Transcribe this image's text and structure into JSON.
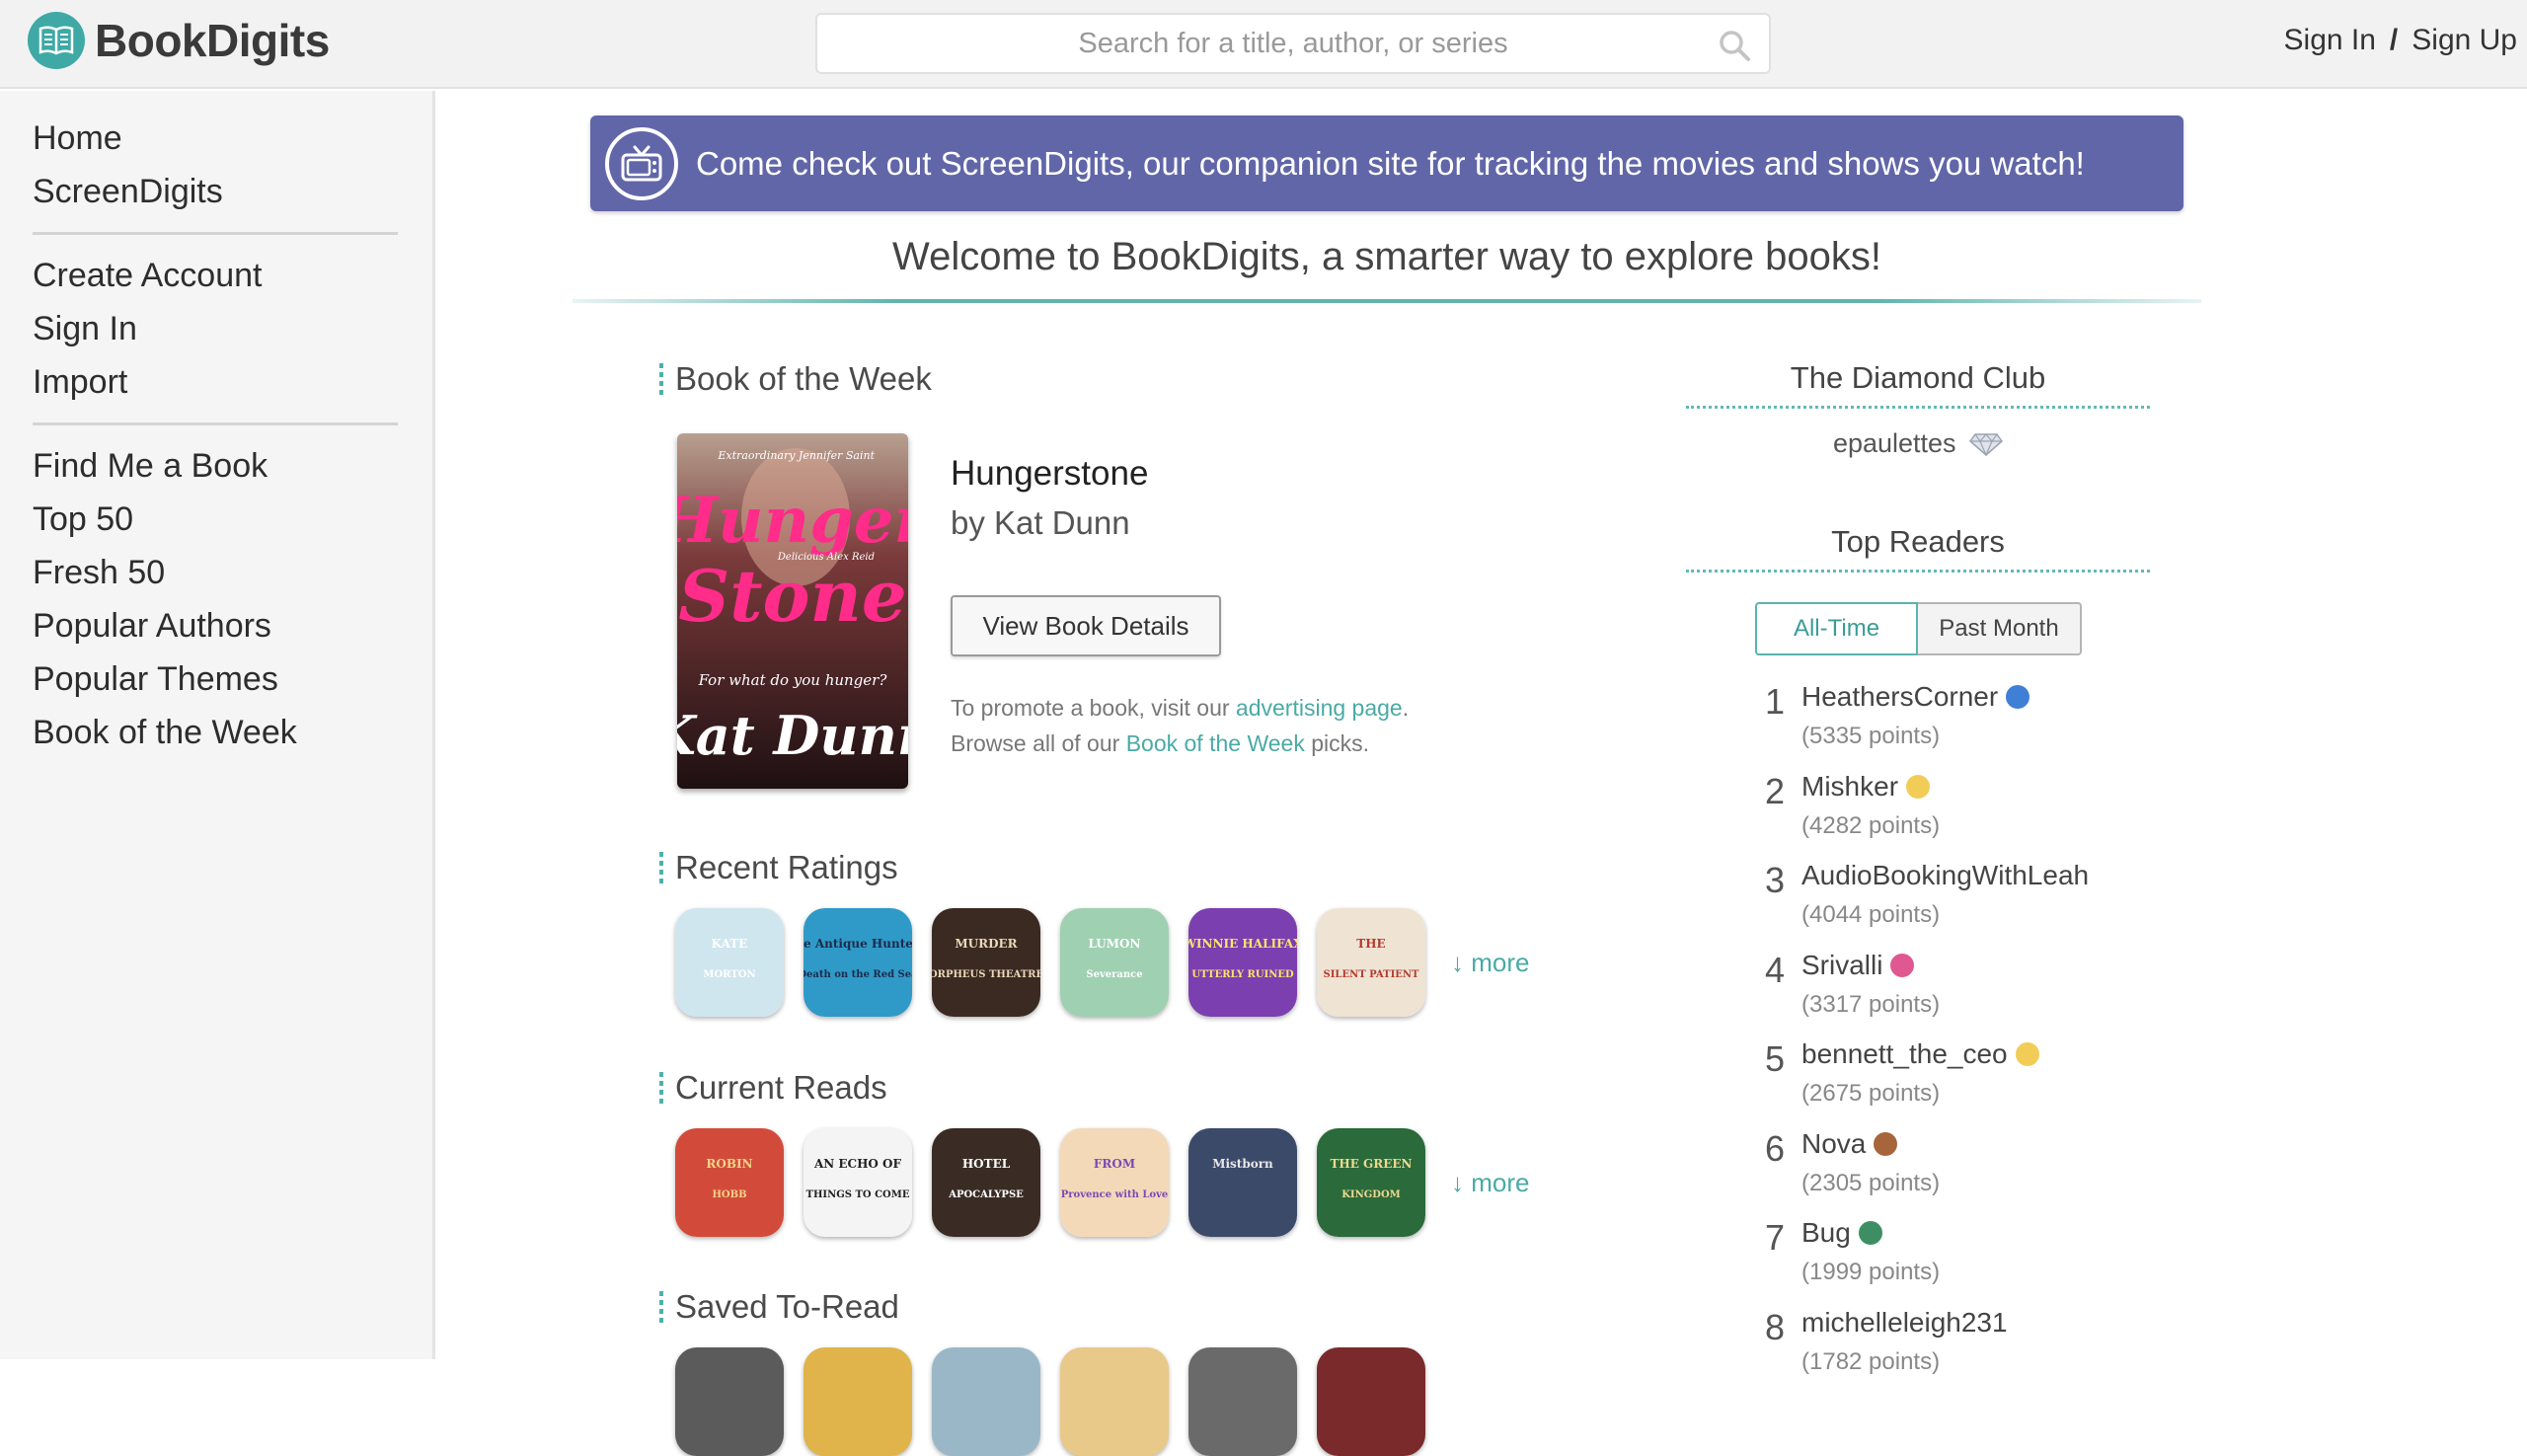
{
  "header": {
    "logo_text": "BookDigits",
    "search_placeholder": "Search for a title, author, or series",
    "sign_in": "Sign In",
    "separator": "/",
    "sign_up": "Sign Up"
  },
  "sidebar": {
    "group1": [
      "Home",
      "ScreenDigits"
    ],
    "group2": [
      "Create Account",
      "Sign In",
      "Import"
    ],
    "group3": [
      "Find Me a Book",
      "Top 50",
      "Fresh 50",
      "Popular Authors",
      "Popular Themes",
      "Book of the Week"
    ]
  },
  "banner": {
    "text": "Come check out ScreenDigits, our companion site for tracking the movies and shows you watch!",
    "color": "#6166a8"
  },
  "welcome": "Welcome to BookDigits, a smarter way to explore books!",
  "book_of_week": {
    "section_title": "Book of the Week",
    "title": "Hungerstone",
    "author": "by Kat Dunn",
    "details_button": "View Book Details",
    "promo_line1_prefix": "To promote a book, visit our ",
    "promo_line1_link": "advertising page",
    "promo_line1_suffix": ".",
    "promo_line2_prefix": "Browse all of our ",
    "promo_line2_link": "Book of the Week",
    "promo_line2_suffix": " picks.",
    "cover_text": {
      "blurb_top": "Extraordinary Jennifer Saint",
      "title_word1": "Hunger",
      "title_word2": "Stone",
      "blurb_mid": "Delicious Alex Reid",
      "tagline": "For what do you hunger?",
      "author": "Kat Dunn"
    }
  },
  "recent_ratings": {
    "section_title": "Recent Ratings",
    "more": "↓ more",
    "covers": [
      {
        "text1": "KATE",
        "text2": "MORTON",
        "bg": "#cfe6ee",
        "fg": "#ffffff"
      },
      {
        "text1": "The Antique Hunter's",
        "text2": "Death on the Red Sea",
        "bg": "#2f9ac8",
        "fg": "#1d2b4a"
      },
      {
        "text1": "MURDER",
        "text2": "ORPHEUS THEATRE",
        "bg": "#3a2a22",
        "fg": "#ead8b8"
      },
      {
        "text1": "LUMON",
        "text2": "Severance",
        "bg": "#9fd0b2",
        "fg": "#ffffff"
      },
      {
        "text1": "WINNIE HALIFAX",
        "text2": "UTTERLY RUINED",
        "bg": "#7b3fb0",
        "fg": "#ffe36a"
      },
      {
        "text1": "THE",
        "text2": "SILENT PATIENT",
        "bg": "#efe3d4",
        "fg": "#b43b2c"
      }
    ]
  },
  "current_reads": {
    "section_title": "Current Reads",
    "more": "↓ more",
    "covers": [
      {
        "text1": "ROBIN",
        "text2": "HOBB",
        "bg": "#d24b3a",
        "fg": "#f3d38a"
      },
      {
        "text1": "AN ECHO OF",
        "text2": "THINGS TO COME",
        "bg": "#f4f4f4",
        "fg": "#222222"
      },
      {
        "text1": "HOTEL",
        "text2": "APOCALYPSE",
        "bg": "#3a2c24",
        "fg": "#ffffff"
      },
      {
        "text1": "FROM",
        "text2": "Provence with Love",
        "bg": "#f3d9b8",
        "fg": "#7b4ab6"
      },
      {
        "text1": "Mistborn",
        "text2": "",
        "bg": "#3c4a6a",
        "fg": "#e8e8e8"
      },
      {
        "text1": "THE GREEN",
        "text2": "KINGDOM",
        "bg": "#2b6a3a",
        "fg": "#f0d890"
      }
    ]
  },
  "saved_to_read": {
    "section_title": "Saved To-Read"
  },
  "diamond_club": {
    "title": "The Diamond Club",
    "member": "epaulettes"
  },
  "top_readers": {
    "title": "Top Readers",
    "tab_all_time": "All-Time",
    "tab_past_month": "Past Month",
    "readers": [
      {
        "rank": "1",
        "name": "HeathersCorner",
        "points": "(5335 points)",
        "badge": "#3f7fd6"
      },
      {
        "rank": "2",
        "name": "Mishker",
        "points": "(4282 points)",
        "badge": "#f1cc57"
      },
      {
        "rank": "3",
        "name": "AudioBookingWithLeah",
        "points": "(4044 points)",
        "badge": ""
      },
      {
        "rank": "4",
        "name": "Srivalli",
        "points": "(3317 points)",
        "badge": "#e05891"
      },
      {
        "rank": "5",
        "name": "bennett_the_ceo",
        "points": "(2675 points)",
        "badge": "#f1cc57"
      },
      {
        "rank": "6",
        "name": "Nova",
        "points": "(2305 points)",
        "badge": "#a6653b"
      },
      {
        "rank": "7",
        "name": "Bug",
        "points": "(1999 points)",
        "badge": "#3d8f63"
      },
      {
        "rank": "8",
        "name": "michelleleigh231",
        "points": "(1782 points)",
        "badge": ""
      }
    ]
  },
  "colors": {
    "accent": "#4aaaa5",
    "banner": "#6166a8",
    "sidebar_bg": "#f5f5f5"
  }
}
